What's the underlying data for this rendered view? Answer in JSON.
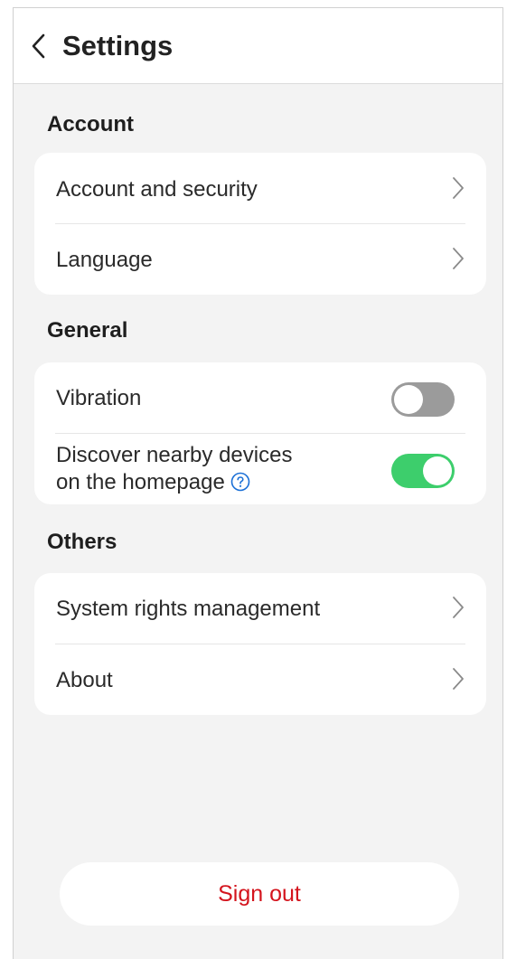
{
  "header": {
    "title": "Settings",
    "back_icon": "chevron-left-icon"
  },
  "sections": [
    {
      "title": "Account",
      "items": [
        {
          "label": "Account and security",
          "type": "link",
          "icon": "chevron-right-icon"
        },
        {
          "label": "Language",
          "type": "link",
          "icon": "chevron-right-icon"
        }
      ]
    },
    {
      "title": "General",
      "items": [
        {
          "label": "Vibration",
          "type": "toggle",
          "enabled": false
        },
        {
          "label_line1": "Discover nearby devices",
          "label_line2": "on the homepage",
          "type": "toggle",
          "enabled": true,
          "help_icon": "help-circle-icon"
        }
      ]
    },
    {
      "title": "Others",
      "items": [
        {
          "label": "System rights management",
          "type": "link",
          "icon": "chevron-right-icon"
        },
        {
          "label": "About",
          "type": "link",
          "icon": "chevron-right-icon"
        }
      ]
    }
  ],
  "footer": {
    "signout_label": "Sign out"
  },
  "colors": {
    "background": "#f3f3f3",
    "card": "#ffffff",
    "toggle_on": "#3dce6c",
    "toggle_off": "#9b9b9b",
    "signout_text": "#d4141d",
    "help_icon": "#1a6fd6"
  }
}
